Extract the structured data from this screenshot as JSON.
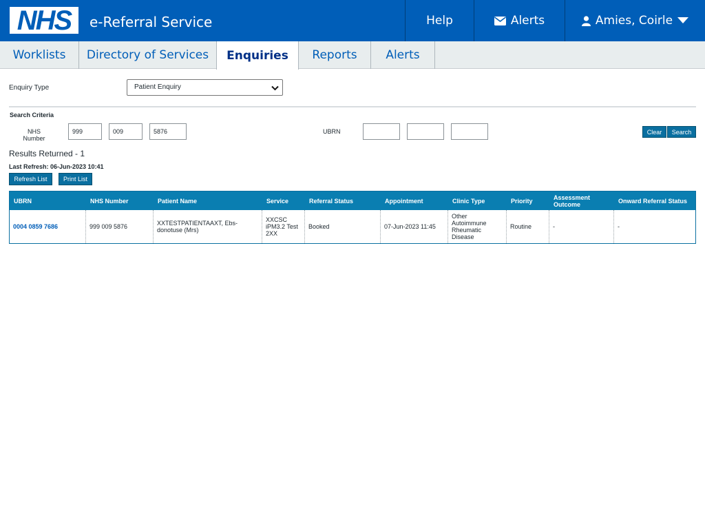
{
  "header": {
    "logo_text": "NHS",
    "service_name": "e-Referral Service",
    "help_label": "Help",
    "alerts_label": "Alerts",
    "user_name": "Amies, Coirle"
  },
  "tabs": [
    {
      "label": "Worklists",
      "active": false
    },
    {
      "label": "Directory of Services",
      "active": false
    },
    {
      "label": "Enquiries",
      "active": true
    },
    {
      "label": "Reports",
      "active": false
    },
    {
      "label": "Alerts",
      "active": false
    }
  ],
  "form": {
    "enquiry_type_label": "Enquiry Type",
    "enquiry_type_value": "Patient Enquiry",
    "search_criteria_label": "Search Criteria",
    "nhs_number_label": "NHS Number",
    "nhs_number_parts": [
      "999",
      "009",
      "5876"
    ],
    "ubrn_label": "UBRN",
    "ubrn_parts": [
      "",
      "",
      ""
    ],
    "clear_label": "Clear",
    "search_label": "Search"
  },
  "results": {
    "returned_text": "Results Returned - 1",
    "last_refresh_text": "Last Refresh: 06-Jun-2023 10:41",
    "refresh_button": "Refresh List",
    "print_button": "Print List"
  },
  "table": {
    "columns": [
      "UBRN",
      "NHS Number",
      "Patient Name",
      "Service",
      "Referral Status",
      "Appointment",
      "Clinic Type",
      "Priority",
      "Assessment Outcome",
      "Onward Referral Status"
    ],
    "rows": [
      [
        "0004 0859 7686",
        "999 009 5876",
        "XXTESTPATIENTAAXT, Ebs-donotuse (Mrs)",
        "XXCSC iPM3.2 Test 2XX",
        "Booked",
        "07-Jun-2023 11:45",
        "Other Autoimmune Rheumatic Disease",
        "Routine",
        "-",
        "-"
      ]
    ]
  },
  "colors": {
    "nhs_blue": "#005eb8",
    "table_header": "#0a7eb1",
    "button": "#0a6fa0"
  },
  "icons": {
    "alerts": "envelope-icon",
    "user": "user-icon",
    "user_menu": "caret-down-icon",
    "select": "chevron-down-icon"
  }
}
